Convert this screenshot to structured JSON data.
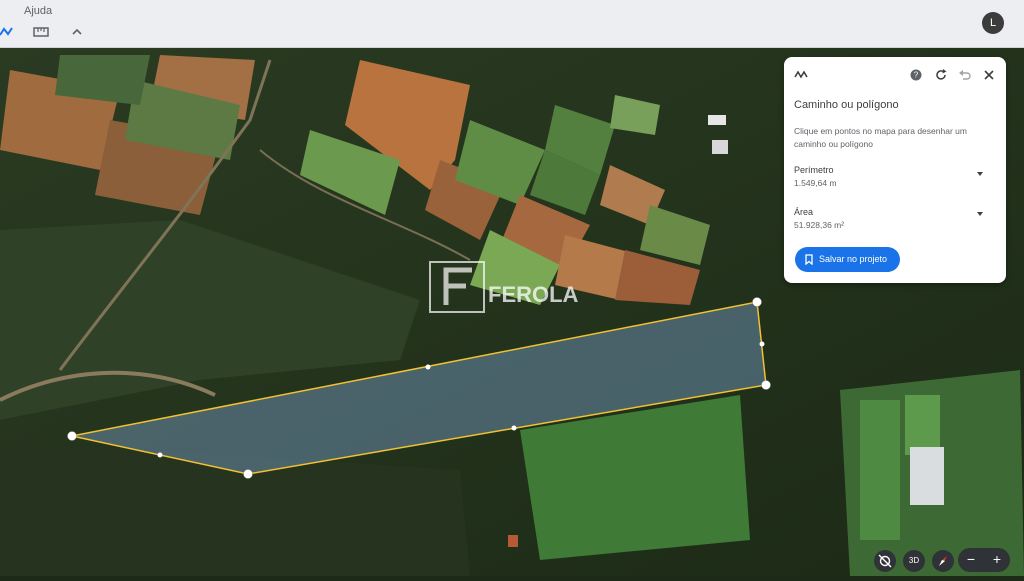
{
  "app": {
    "menu": {
      "ajuda": "Ajuda"
    },
    "avatar_initial": "L",
    "toolbar_icons": [
      "measure-icon",
      "ruler-icon",
      "chevron-up-icon"
    ]
  },
  "map": {
    "watermark": "FEROLA",
    "layer": "satellite"
  },
  "panel": {
    "title": "Caminho ou polígono",
    "instruction": "Clique em pontos no mapa para desenhar um caminho ou polígono",
    "header_icons": [
      "path-icon",
      "help-icon",
      "refresh-icon",
      "undo-icon",
      "close-icon"
    ],
    "perimeter": {
      "label": "Perímetro",
      "value": "1.549,64 m"
    },
    "area": {
      "label": "Área",
      "value": "51.928,36 m²"
    },
    "save_button": "Salvar no projeto"
  },
  "controls": {
    "view_3d": "3D",
    "zoom_out": "−",
    "zoom_in": "+"
  },
  "colors": {
    "polygon_stroke": "#f2c230",
    "accent_blue": "#1a73e8",
    "panel_bg": "#ffffff"
  }
}
